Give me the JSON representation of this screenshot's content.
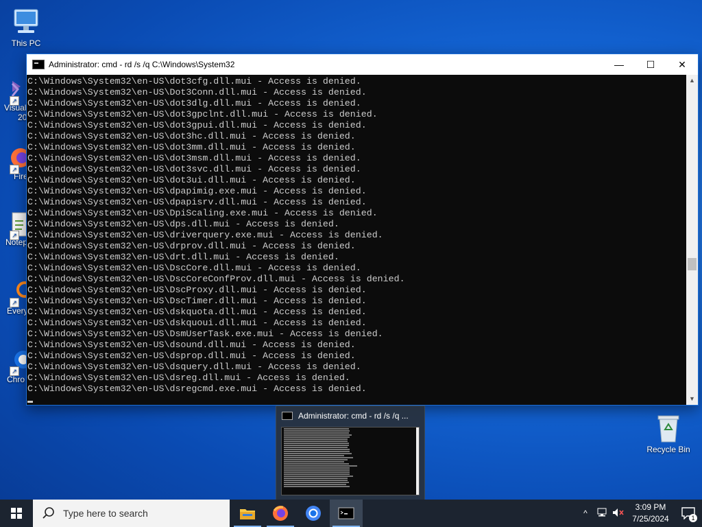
{
  "desktop": {
    "icons": [
      {
        "label": "This PC",
        "icon": "computer-icon"
      },
      {
        "label": "Recycle Bin",
        "icon": "recycle-bin-icon"
      }
    ],
    "partial_labels": [
      "Visual",
      "20",
      "Fire",
      "Notep",
      "Every",
      "Chro"
    ]
  },
  "window": {
    "title": "Administrator: cmd - rd  /s /q C:\\Windows\\System32",
    "minimize": "—",
    "maximize": "☐",
    "close": "✕",
    "console_lines": [
      "C:\\Windows\\System32\\en-US\\dot3cfg.dll.mui - Access is denied.",
      "C:\\Windows\\System32\\en-US\\Dot3Conn.dll.mui - Access is denied.",
      "C:\\Windows\\System32\\en-US\\dot3dlg.dll.mui - Access is denied.",
      "C:\\Windows\\System32\\en-US\\dot3gpclnt.dll.mui - Access is denied.",
      "C:\\Windows\\System32\\en-US\\dot3gpui.dll.mui - Access is denied.",
      "C:\\Windows\\System32\\en-US\\dot3hc.dll.mui - Access is denied.",
      "C:\\Windows\\System32\\en-US\\dot3mm.dll.mui - Access is denied.",
      "C:\\Windows\\System32\\en-US\\dot3msm.dll.mui - Access is denied.",
      "C:\\Windows\\System32\\en-US\\dot3svc.dll.mui - Access is denied.",
      "C:\\Windows\\System32\\en-US\\dot3ui.dll.mui - Access is denied.",
      "C:\\Windows\\System32\\en-US\\dpapimig.exe.mui - Access is denied.",
      "C:\\Windows\\System32\\en-US\\dpapisrv.dll.mui - Access is denied.",
      "C:\\Windows\\System32\\en-US\\DpiScaling.exe.mui - Access is denied.",
      "C:\\Windows\\System32\\en-US\\dps.dll.mui - Access is denied.",
      "C:\\Windows\\System32\\en-US\\driverquery.exe.mui - Access is denied.",
      "C:\\Windows\\System32\\en-US\\drprov.dll.mui - Access is denied.",
      "C:\\Windows\\System32\\en-US\\drt.dll.mui - Access is denied.",
      "C:\\Windows\\System32\\en-US\\DscCore.dll.mui - Access is denied.",
      "C:\\Windows\\System32\\en-US\\DscCoreConfProv.dll.mui - Access is denied.",
      "C:\\Windows\\System32\\en-US\\DscProxy.dll.mui - Access is denied.",
      "C:\\Windows\\System32\\en-US\\DscTimer.dll.mui - Access is denied.",
      "C:\\Windows\\System32\\en-US\\dskquota.dll.mui - Access is denied.",
      "C:\\Windows\\System32\\en-US\\dskquoui.dll.mui - Access is denied.",
      "C:\\Windows\\System32\\en-US\\DsmUserTask.exe.mui - Access is denied.",
      "C:\\Windows\\System32\\en-US\\dsound.dll.mui - Access is denied.",
      "C:\\Windows\\System32\\en-US\\dsprop.dll.mui - Access is denied.",
      "C:\\Windows\\System32\\en-US\\dsquery.dll.mui - Access is denied.",
      "C:\\Windows\\System32\\en-US\\dsreg.dll.mui - Access is denied.",
      "C:\\Windows\\System32\\en-US\\dsregcmd.exe.mui - Access is denied."
    ]
  },
  "thumbnail": {
    "title": "Administrator: cmd - rd  /s /q ..."
  },
  "taskbar": {
    "search_placeholder": "Type here to search",
    "apps": [
      "file-explorer-icon",
      "firefox-icon",
      "chrome-icon",
      "cmd-icon"
    ],
    "clock_time": "3:09 PM",
    "clock_date": "7/25/2024",
    "notification_count": "1"
  },
  "colors": {
    "console_bg": "#0c0c0c",
    "console_fg": "#cccccc",
    "taskbar_bg": "#1c2430",
    "desktop_blue": "#1466d6"
  }
}
